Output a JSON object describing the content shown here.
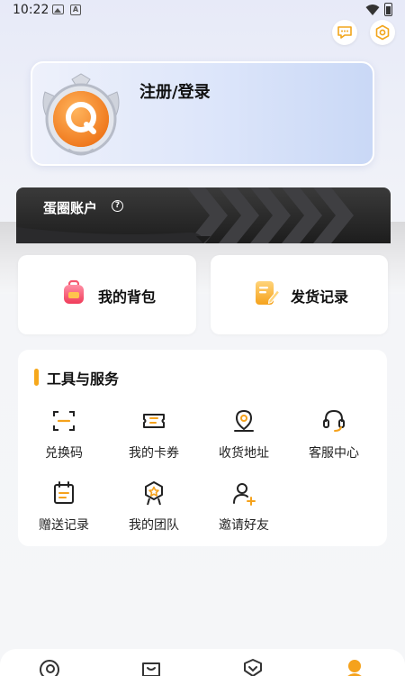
{
  "status_bar": {
    "time": "10:22",
    "icons": [
      "photo-icon",
      "a-icon",
      "wifi-icon",
      "battery-icon"
    ]
  },
  "header": {
    "icons": [
      "message-icon",
      "settings-icon"
    ]
  },
  "profile": {
    "login_label": "注册/登录",
    "avatar": "avatar-badge"
  },
  "account": {
    "title": "蛋圈账户",
    "icon": "help-icon"
  },
  "quick_actions": [
    {
      "label": "我的背包",
      "icon": "backpack-icon"
    },
    {
      "label": "发货记录",
      "icon": "shipping-record-icon"
    }
  ],
  "tools": {
    "title": "工具与服务",
    "items": [
      {
        "label": "兑换码",
        "icon": "scan-code-icon"
      },
      {
        "label": "我的卡券",
        "icon": "coupon-icon"
      },
      {
        "label": "收货地址",
        "icon": "location-icon"
      },
      {
        "label": "客服中心",
        "icon": "headset-icon"
      },
      {
        "label": "赠送记录",
        "icon": "calendar-icon"
      },
      {
        "label": "我的团队",
        "icon": "team-badge-icon"
      },
      {
        "label": "邀请好友",
        "icon": "add-user-icon"
      }
    ]
  },
  "tab_bar": {
    "icons": [
      "home-icon",
      "bag-icon",
      "shield-icon",
      "profile-icon"
    ],
    "active_index": 3
  },
  "colors": {
    "accent": "#f6a81c",
    "banner_dark": "#1d1d1d",
    "card_blue": "#c9d8f6"
  }
}
